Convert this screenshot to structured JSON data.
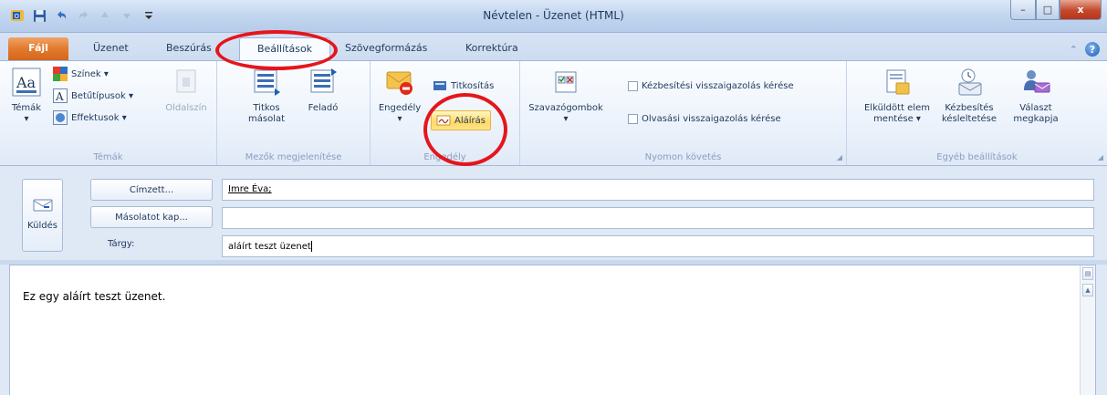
{
  "window": {
    "title": "Névtelen - Üzenet (HTML)",
    "controls": {
      "minimize": "–",
      "maximize": "□",
      "close": "x"
    }
  },
  "tabs": [
    {
      "label": "Fájl"
    },
    {
      "label": "Üzenet"
    },
    {
      "label": "Beszúrás"
    },
    {
      "label": "Beállítások",
      "active": true
    },
    {
      "label": "Szövegformázás"
    },
    {
      "label": "Korrektúra"
    }
  ],
  "ribbon": {
    "temak": {
      "label": "Témák",
      "temak_btn": "Témák",
      "szinek": "Színek ▾",
      "betutipusok": "Betűtípusok ▾",
      "effektusok": "Effektusok ▾",
      "oldalszin": "Oldalszín"
    },
    "mezok": {
      "label": "Mezők megjelenítése",
      "titkos_line1": "Titkos",
      "titkos_line2": "másolat",
      "felado": "Feladó"
    },
    "engedely": {
      "label": "Engedély",
      "engedely_btn": "Engedély",
      "titkositas": "Titkosítás",
      "alairas": "Aláírás"
    },
    "nyomon": {
      "label": "Nyomon követés",
      "szavazogombok": "Szavazógombok",
      "kezbesitesi": "Kézbesítési visszaigazolás kérése",
      "olvasasi": "Olvasási visszaigazolás kérése"
    },
    "egyeb": {
      "label": "Egyéb beállítások",
      "elkuldott_line1": "Elküldött elem",
      "elkuldott_line2": "mentése ▾",
      "kesleltetes_line1": "Kézbesítés",
      "kesleltetes_line2": "késleltetése",
      "valasz_line1": "Választ",
      "valasz_line2": "megkapja"
    }
  },
  "compose": {
    "send_label": "Küldés",
    "to_button": "Címzett...",
    "cc_button": "Másolatot kap...",
    "subject_label": "Tárgy:",
    "to_value": "Imre Éva;",
    "cc_value": "",
    "subject_value": "aláírt teszt üzenet",
    "body_text": "Ez egy aláírt teszt üzenet."
  },
  "colors": {
    "annotation": "#e5151c",
    "file_tab": "#e27a2d",
    "highlight": "#ffd964"
  }
}
